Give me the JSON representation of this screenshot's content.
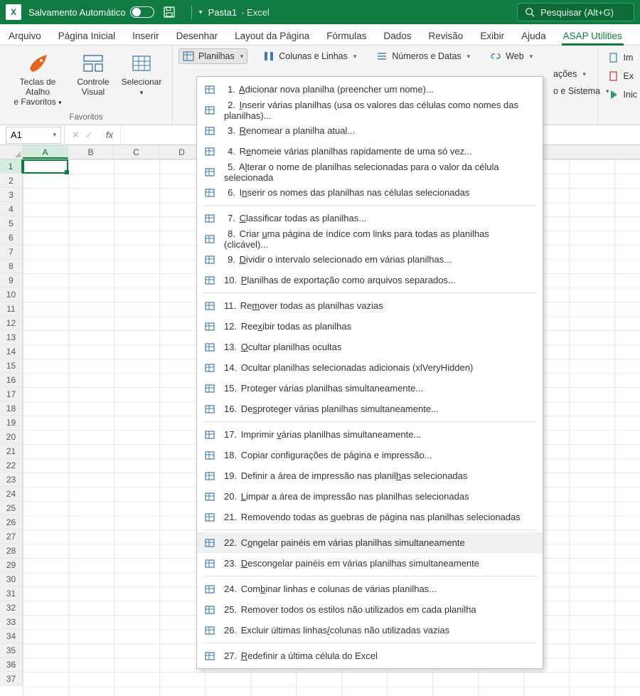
{
  "titlebar": {
    "autosave": "Salvamento Automático",
    "doc_name": "Pasta1",
    "doc_app": "Excel",
    "search_placeholder": "Pesquisar (Alt+G)"
  },
  "tabs": [
    "Arquivo",
    "Página Inicial",
    "Inserir",
    "Desenhar",
    "Layout da Página",
    "Fórmulas",
    "Dados",
    "Revisão",
    "Exibir",
    "Ajuda",
    "ASAP Utilities"
  ],
  "active_tab": "ASAP Utilities",
  "ribbon": {
    "favoritos": {
      "btn1_l1": "Teclas de Atalho",
      "btn1_l2": "e Favoritos",
      "btn2_l1": "Controle",
      "btn2_l2": "Visual",
      "btn3": "Selecionar",
      "group_label": "Favoritos"
    },
    "row1": {
      "planilhas": "Planilhas",
      "colunas": "Colunas e Linhas",
      "numeros": "Números e Datas",
      "web": "Web"
    },
    "right_partial": {
      "acoes": "ações",
      "sistema": "o e Sistema",
      "imp": "Im",
      "exp": "Ex",
      "inic": "Inic"
    }
  },
  "namebox": "A1",
  "columns": [
    "A",
    "B",
    "C",
    "D",
    "",
    "",
    "",
    "",
    "M",
    "N"
  ],
  "menu_items": [
    {
      "n": "1.",
      "pre": "",
      "u": "A",
      "post": "dicionar nova planilha (preencher um nome)...",
      "ic": "sheet-add"
    },
    {
      "n": "2.",
      "pre": "",
      "u": "I",
      "post": "nserir várias planilhas (usa os valores das células como nomes das planilhas)...",
      "ic": "sheets"
    },
    {
      "n": "3.",
      "pre": "",
      "u": "R",
      "post": "enomear a planilha atual...",
      "ic": "rename"
    },
    {
      "n": "4.",
      "pre": "R",
      "u": "e",
      "post": "nomeie várias planilhas rapidamente de uma só vez...",
      "ic": "rename-multi"
    },
    {
      "n": "5.",
      "pre": "A",
      "u": "l",
      "post": "terar o nome de planilhas selecionadas para o valor da célula selecionada",
      "ic": "cell-name"
    },
    {
      "n": "6.",
      "pre": "I",
      "u": "n",
      "post": "serir os nomes das planilhas nas células selecionadas",
      "ic": "insert-names"
    },
    {
      "sep": true
    },
    {
      "n": "7.",
      "pre": "",
      "u": "C",
      "post": "lassificar todas as planilhas...",
      "ic": "sort"
    },
    {
      "n": "8.",
      "pre": "Criar ",
      "u": "u",
      "post": "ma página de índice com links para todas as planilhas (clicável)...",
      "ic": "index"
    },
    {
      "n": "9.",
      "pre": "",
      "u": "D",
      "post": "ividir o intervalo selecionado em várias planilhas...",
      "ic": "split"
    },
    {
      "n": "10.",
      "pre": "",
      "u": "P",
      "post": "lanilhas de exportação como arquivos separados...",
      "ic": "export"
    },
    {
      "sep": true
    },
    {
      "n": "11.",
      "pre": "Re",
      "u": "m",
      "post": "over todas as planilhas vazias",
      "ic": "remove-empty"
    },
    {
      "n": "12.",
      "pre": "Ree",
      "u": "x",
      "post": "ibir todas as planilhas",
      "ic": "unhide"
    },
    {
      "n": "13.",
      "pre": "",
      "u": "O",
      "post": "cultar planilhas ocultas",
      "ic": "hide"
    },
    {
      "n": "14.",
      "pre": "Ocultar planilhas selecionadas adicionais (xlVeryHidden)",
      "u": "",
      "post": "",
      "ic": "very-hide"
    },
    {
      "n": "15.",
      "pre": "Proteger várias planilhas simultaneamente...",
      "u": "",
      "post": "",
      "ic": "protect"
    },
    {
      "n": "16.",
      "pre": "De",
      "u": "s",
      "post": "proteger várias planilhas simultaneamente...",
      "ic": "unprotect"
    },
    {
      "sep": true
    },
    {
      "n": "17.",
      "pre": "Imprimir ",
      "u": "v",
      "post": "árias planilhas simultaneamente...",
      "ic": "print"
    },
    {
      "n": "18.",
      "pre": "Copiar configurações de página e impressão...",
      "u": "",
      "post": "",
      "ic": "copy-page"
    },
    {
      "n": "19.",
      "pre": "Definir a área de impressão nas planil",
      "u": "h",
      "post": "as selecionadas",
      "ic": "set-area"
    },
    {
      "n": "20.",
      "pre": "",
      "u": "L",
      "post": "impar a área de impressão nas planilhas selecionadas",
      "ic": "clear-area"
    },
    {
      "n": "21.",
      "pre": "Removendo todas as ",
      "u": "q",
      "post": "uebras de página nas planilhas selecionadas",
      "ic": "remove-breaks"
    },
    {
      "sep": true
    },
    {
      "n": "22.",
      "pre": "C",
      "u": "o",
      "post": "ngelar painéis em várias planilhas simultaneamente",
      "ic": "freeze",
      "hover": true
    },
    {
      "n": "23.",
      "pre": "",
      "u": "D",
      "post": "escongelar painéis em várias planilhas simultaneamente",
      "ic": "unfreeze"
    },
    {
      "sep": true
    },
    {
      "n": "24.",
      "pre": "Com",
      "u": "b",
      "post": "inar linhas e colunas de várias planilhas...",
      "ic": "combine"
    },
    {
      "n": "25.",
      "pre": "Remover todos os estilos não utilizados em cada planilha",
      "u": "",
      "post": "",
      "ic": "remove-styles"
    },
    {
      "n": "26.",
      "pre": "Excluir últimas linhas",
      "u": "/",
      "post": "colunas não utilizadas vazias",
      "ic": "del-last"
    },
    {
      "sep": true
    },
    {
      "n": "27.",
      "pre": "",
      "u": "R",
      "post": "edefinir a última célula do Excel",
      "ic": "reset"
    }
  ]
}
